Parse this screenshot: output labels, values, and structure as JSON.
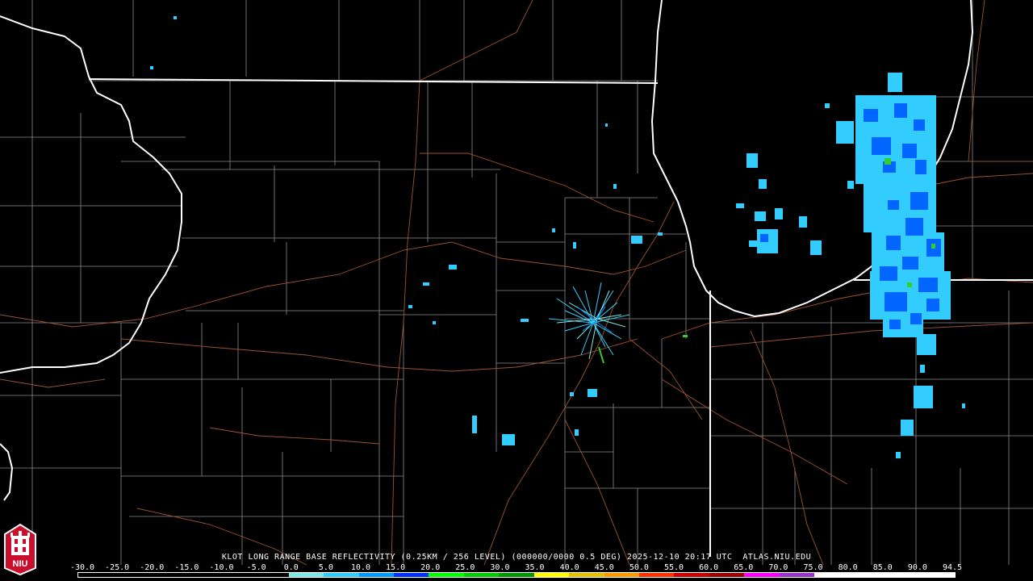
{
  "map": {
    "title": "KLOT LONG RANGE BASE REFLECTIVITY (0.25KM / 256 LEVEL) (000000/0000 0.5 DEG) 2025-12-10 20:17 UTC  ATLAS.NIU.EDU",
    "background_color": "#000000",
    "state_border_color": "#ffffff",
    "county_border_color": "#8a8a8a",
    "road_color": "#a0522d"
  },
  "scale": {
    "labels": [
      "-30.0",
      "-25.0",
      "-20.0",
      "-15.0",
      "-10.0",
      "-5.0",
      "0.0",
      "5.0",
      "10.0",
      "15.0",
      "20.0",
      "25.0",
      "30.0",
      "35.0",
      "40.0",
      "45.0",
      "50.0",
      "55.0",
      "60.0",
      "65.0",
      "70.0",
      "75.0",
      "80.0",
      "85.0",
      "90.0",
      "94.5"
    ],
    "colors": [
      "#000000",
      "#000000",
      "#000000",
      "#000000",
      "#000000",
      "#000000",
      "#7fe6e6",
      "#33ccff",
      "#0099ff",
      "#0033ff",
      "#00ff00",
      "#00cc00",
      "#009900",
      "#ffff00",
      "#e6c000",
      "#ff9900",
      "#ff3300",
      "#cc0000",
      "#990000",
      "#ff00ff",
      "#9933cc",
      "#ffffff",
      "#ffffff",
      "#ffffff",
      "#ffffff"
    ]
  },
  "logo": {
    "text": "NIU",
    "color": "#c8102e"
  }
}
